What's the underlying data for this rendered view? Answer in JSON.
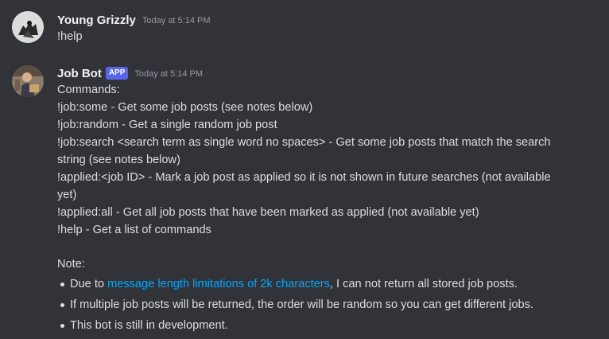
{
  "messages": [
    {
      "username": "Young Grizzly",
      "timestamp": "Today at 5:14 PM",
      "content": "!help"
    },
    {
      "username": "Job Bot",
      "badge": "APP",
      "timestamp": "Today at 5:14 PM",
      "lines": [
        "Commands:",
        "!job:some - Get some job posts (see notes below)",
        "!job:random - Get a single random job post",
        "!job:search <search term as single word no spaces> - Get some job posts that match the search",
        "string (see notes below)",
        "!applied:<job ID> - Mark a job post as applied so it is not shown in future searches (not available",
        "yet)",
        "!applied:all - Get all job posts that have been marked as applied (not available yet)",
        "!help - Get a list of commands",
        "Note:"
      ],
      "notes": {
        "note1_prefix": "Due to ",
        "note1_link": "message length limitations of 2k characters",
        "note1_suffix": ", I can not return all stored job posts.",
        "note2": "If multiple job posts will be returned, the order will be random so you can get different jobs.",
        "note3": "This bot is still in development."
      }
    }
  ],
  "colors": {
    "background": "#313338",
    "text": "#dbdee1",
    "username": "#f2f3f5",
    "timestamp": "#949ba4",
    "badge": "#5865f2",
    "link": "#00a8fc"
  },
  "icons": {
    "user_avatar": "grizzly-avatar",
    "bot_avatar": "job-bot-avatar"
  }
}
